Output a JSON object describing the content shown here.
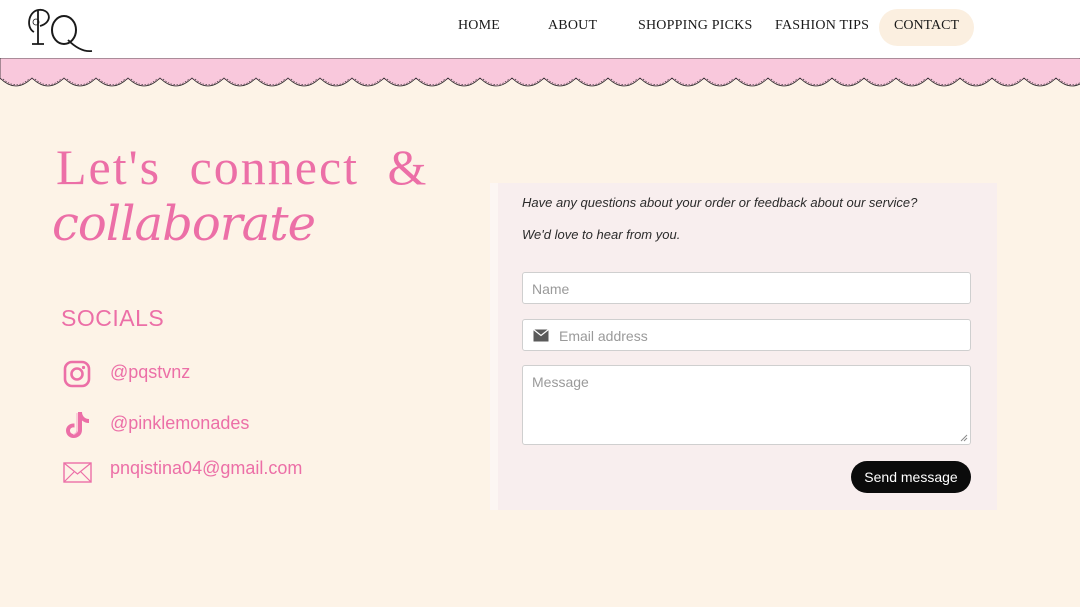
{
  "header": {
    "logo_text": "PQ",
    "nav": [
      {
        "label": "HOME"
      },
      {
        "label": "ABOUT"
      },
      {
        "label": "SHOPPING PICKS"
      },
      {
        "label": "FASHION TIPS"
      },
      {
        "label": "CONTACT"
      }
    ]
  },
  "hero": {
    "line1": "Let's connect &",
    "line2": "collaborate"
  },
  "socials": {
    "title": "SOCIALS",
    "items": [
      {
        "icon": "instagram-icon",
        "label": "@pqstvnz"
      },
      {
        "icon": "tiktok-icon",
        "label": "@pinklemonades"
      },
      {
        "icon": "envelope-icon",
        "label": "pnqistina04@gmail.com"
      }
    ]
  },
  "form": {
    "intro1": "Have any questions about your order or feedback about our service?",
    "intro2": "We'd love to hear from you.",
    "name_placeholder": "Name",
    "email_placeholder": "Email address",
    "message_placeholder": "Message",
    "send_label": "Send message"
  },
  "colors": {
    "accent_pink": "#ec6fa7",
    "band_pink": "#f9c8dc",
    "background": "#fdf3e7",
    "button": "#0b0b0b"
  }
}
